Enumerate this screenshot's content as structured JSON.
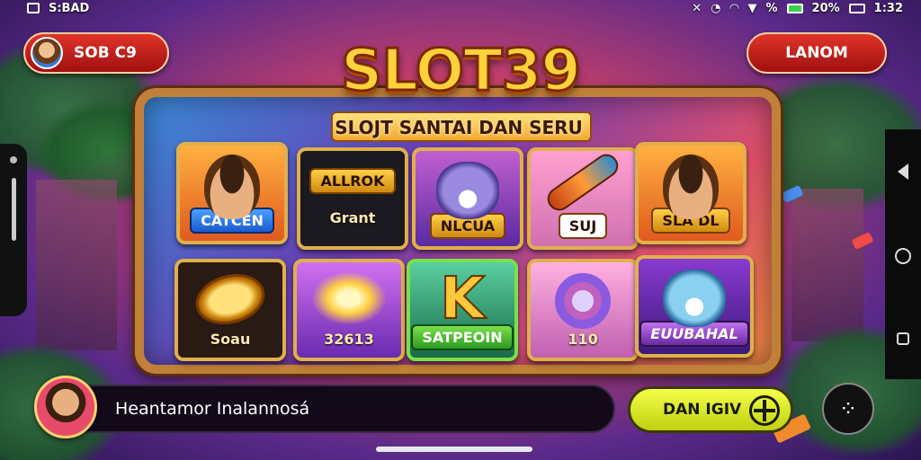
{
  "status_bar": {
    "left_text": "S:BAD",
    "right_pct_1": "%",
    "right_pct_2": "20%",
    "right_time": "1:32"
  },
  "top": {
    "left_pill_label": "SOB C9",
    "right_pill_label": "LANOM"
  },
  "header": {
    "logo": "SLOT39",
    "tagline": "SLOJT SANTAI DAN SERU"
  },
  "tiles": [
    {
      "label": "CATCEN",
      "icon": "man-portrait-icon",
      "style": "blue"
    },
    {
      "label": "ALLROK",
      "sub": "Grant",
      "icon": "gold-banner-icon",
      "style": "gold"
    },
    {
      "label": "NLCUA",
      "icon": "wolf-icon",
      "style": "gold"
    },
    {
      "label": "SUJ",
      "icon": "rocket-tube-icon",
      "style": "gold"
    },
    {
      "label": "SLA DL",
      "icon": "man-portrait-icon",
      "style": "gold"
    },
    {
      "label": "Soau",
      "icon": "gold-coin-icon",
      "style": "plain"
    },
    {
      "label": "32613",
      "icon": "coin-burst-icon",
      "style": "plain"
    },
    {
      "label": "SATPEOIN",
      "icon": "letter-k-icon",
      "style": "green"
    },
    {
      "label": "110",
      "icon": "ring-icon",
      "style": "plain"
    },
    {
      "label": "EUUBAHAL",
      "icon": "bear-icon",
      "style": "purple"
    }
  ],
  "bottom": {
    "user_name": "Heantamor Inalannosá",
    "cta_label": "DAN IGIV"
  },
  "colors": {
    "accent_red": "#d02a20",
    "cta_yellow": "#e8f43a",
    "frame_gold": "#c0803a"
  }
}
